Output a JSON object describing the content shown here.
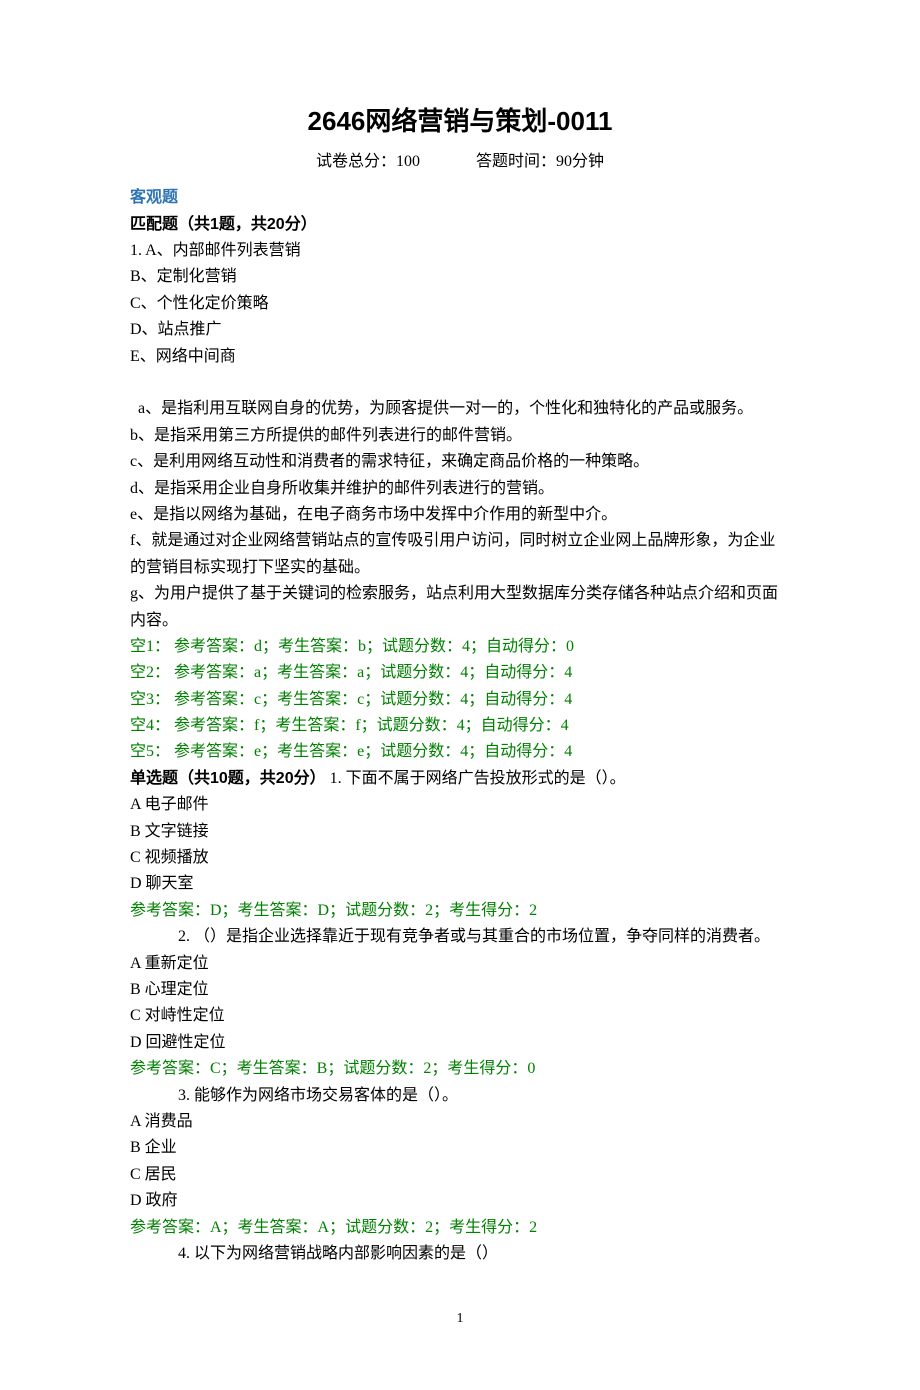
{
  "title": "2646网络营销与策划-0011",
  "sub_score_label": "试卷总分：100",
  "sub_time_label": "答题时间：90分钟",
  "objective_header": "客观题",
  "match_header": "匹配题（共1题，共20分）",
  "match": {
    "q1_leader": "1. A、内部邮件列表营销",
    "optB": "B、定制化营销",
    "optC": "C、个性化定价策略",
    "optD": "D、站点推广",
    "optE": "E、网络中间商",
    "desc_a_indent": "  a、是指利用互联网自身的优势，为顾客提供一对一的，个性化和独特化的产品或服务。",
    "desc_b": "b、是指采用第三方所提供的邮件列表进行的邮件营销。",
    "desc_c": "c、是利用网络互动性和消费者的需求特征，来确定商品价格的一种策略。",
    "desc_d": "d、是指采用企业自身所收集并维护的邮件列表进行的营销。",
    "desc_e": "e、是指以网络为基础，在电子商务市场中发挥中介作用的新型中介。",
    "desc_f": "f、就是通过对企业网络营销站点的宣传吸引用户访问，同时树立企业网上品牌形象，为企业的营销目标实现打下坚实的基础。",
    "desc_g": "g、为用户提供了基于关键词的检索服务，站点利用大型数据库分类存储各种站点介绍和页面内容。",
    "blank1": "空1：  参考答案：d；考生答案：b；试题分数：4；自动得分：0",
    "blank2": "空2：  参考答案：a；考生答案：a；试题分数：4；自动得分：4",
    "blank3": "空3：  参考答案：c；考生答案：c；试题分数：4；自动得分：4",
    "blank4": "空4：  参考答案：f；考生答案：f；试题分数：4；自动得分：4",
    "blank5": "空5：  参考答案：e；考生答案：e；试题分数：4；自动得分：4"
  },
  "single_header": "单选题（共10题，共20分）",
  "q1": {
    "stem": "1.  下面不属于网络广告投放形式的是（）。",
    "A": "A    电子邮件",
    "B": "B    文字链接",
    "C": "C    视频播放",
    "D": "D    聊天室",
    "ans": "参考答案：D；考生答案：D；试题分数：2；考生得分：2"
  },
  "q2": {
    "stem": "2.  （）是指企业选择靠近于现有竞争者或与其重合的市场位置，争夺同样的消费者。",
    "A": "A    重新定位",
    "B": "B    心理定位",
    "C": "C    对峙性定位",
    "D": "D    回避性定位",
    "ans": "参考答案：C；考生答案：B；试题分数：2；考生得分：0"
  },
  "q3": {
    "stem": "3.  能够作为网络市场交易客体的是（）。",
    "A": "A    消费品",
    "B": "B    企业",
    "C": "C    居民",
    "D": "D    政府",
    "ans": "参考答案：A；考生答案：A；试题分数：2；考生得分：2"
  },
  "q4": {
    "stem": "4.  以下为网络营销战略内部影响因素的是（）"
  },
  "page_number": "1"
}
